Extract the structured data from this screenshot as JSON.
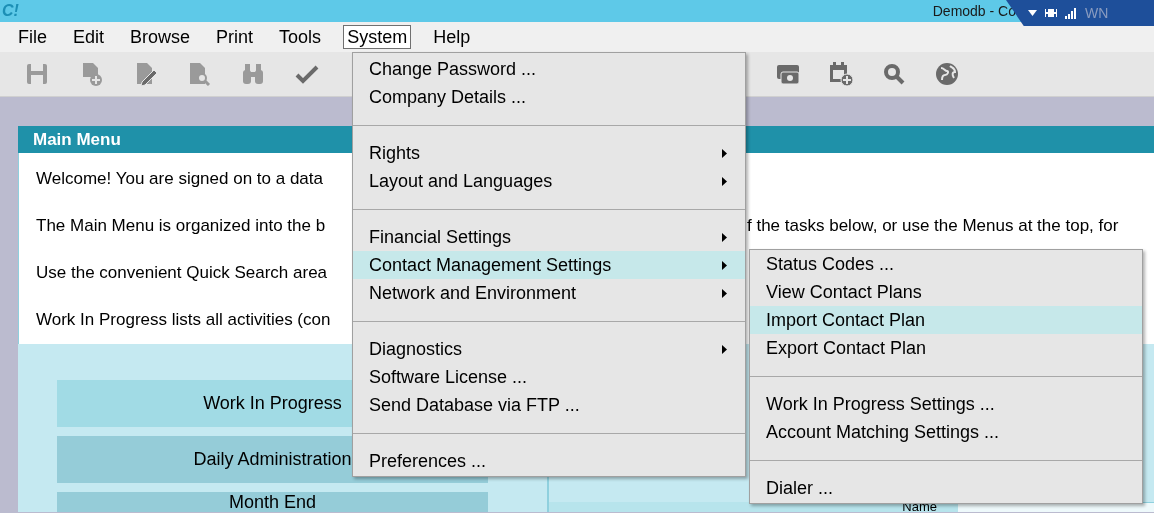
{
  "title_bar": {
    "logo": "C!",
    "title": "Demodb - Co",
    "tray_text": "WN"
  },
  "menubar": [
    {
      "label": "File",
      "selected": false
    },
    {
      "label": "Edit",
      "selected": false
    },
    {
      "label": "Browse",
      "selected": false
    },
    {
      "label": "Print",
      "selected": false
    },
    {
      "label": "Tools",
      "selected": false
    },
    {
      "label": "System",
      "selected": true
    },
    {
      "label": "Help",
      "selected": false
    }
  ],
  "main_menu": {
    "title": "Main Menu",
    "paragraphs": [
      {
        "text": "Welcome! You are signed on to a data"
      },
      {
        "text": "The Main Menu is organized into the b",
        "right_parts": [
          "f the tasks below, or use the Menus at the top, for"
        ]
      },
      {
        "text": "Use the convenient Quick Search area"
      },
      {
        "text": "Work In Progress lists all activities (con"
      }
    ],
    "buttons": [
      {
        "label": "Work In Progress",
        "highlighted": true
      },
      {
        "label": "Daily Administration",
        "highlighted": false
      },
      {
        "label": "Month End",
        "highlighted": false
      }
    ],
    "name_label": "Name"
  },
  "system_menu": [
    {
      "kind": "item",
      "label": "Change Password ..."
    },
    {
      "kind": "item",
      "label": "Company Details ..."
    },
    {
      "kind": "separator"
    },
    {
      "kind": "submenu",
      "label": "Rights",
      "selected": false
    },
    {
      "kind": "submenu",
      "label": "Layout and Languages",
      "selected": false
    },
    {
      "kind": "separator"
    },
    {
      "kind": "submenu",
      "label": "Financial Settings",
      "selected": false
    },
    {
      "kind": "submenu",
      "label": "Contact Management Settings",
      "selected": true
    },
    {
      "kind": "submenu",
      "label": "Network and Environment",
      "selected": false
    },
    {
      "kind": "separator"
    },
    {
      "kind": "submenu",
      "label": "Diagnostics",
      "selected": false
    },
    {
      "kind": "item",
      "label": "Software License ..."
    },
    {
      "kind": "item",
      "label": "Send Database via FTP ..."
    },
    {
      "kind": "separator"
    },
    {
      "kind": "item",
      "label": "Preferences ..."
    }
  ],
  "contact_submenu": [
    {
      "kind": "item",
      "label": "Status Codes ...",
      "selected": false
    },
    {
      "kind": "item",
      "label": "View Contact Plans",
      "selected": false
    },
    {
      "kind": "item",
      "label": "Import Contact Plan",
      "selected": true
    },
    {
      "kind": "item",
      "label": "Export Contact Plan",
      "selected": false
    },
    {
      "kind": "separator"
    },
    {
      "kind": "item",
      "label": "Work In Progress Settings ...",
      "selected": false
    },
    {
      "kind": "item",
      "label": "Account Matching Settings ...",
      "selected": false
    },
    {
      "kind": "separator"
    },
    {
      "kind": "item",
      "label": "Dialer ...",
      "selected": false
    }
  ]
}
